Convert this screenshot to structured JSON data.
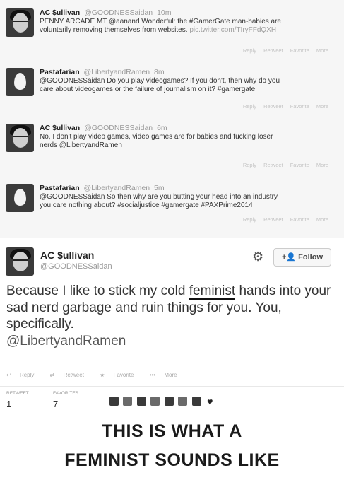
{
  "feed": [
    {
      "name": "AC $ullivan",
      "handle": "@GOODNESSaidan",
      "time": "10m",
      "text_lines": [
        "PENNY ARCADE MT @aanand Wonderful: the #GamerGate man-babies are",
        "voluntarily removing themselves from websites."
      ],
      "link": "pic.twitter.com/TIryFFdQXH",
      "actions": [
        "Reply",
        "Retweet",
        "Favorite",
        "More"
      ],
      "avatar": "photo"
    },
    {
      "name": "Pastafarian",
      "handle": "@LibertyandRamen",
      "time": "8m",
      "text_lines": [
        "@GOODNESSaidan Do you play videogames? If you don't, then why do you",
        "care about videogames or the failure of journalism on it? #gamergate"
      ],
      "link": "",
      "actions": [
        "Reply",
        "Retweet",
        "Favorite",
        "More"
      ],
      "avatar": "egg"
    },
    {
      "name": "AC $ullivan",
      "handle": "@GOODNESSaidan",
      "time": "6m",
      "text_lines": [
        "No, I don't play video games, video games are for babies and fucking loser",
        "nerds @LibertyandRamen"
      ],
      "link": "",
      "actions": [
        "Reply",
        "Retweet",
        "Favorite",
        "More"
      ],
      "avatar": "photo"
    },
    {
      "name": "Pastafarian",
      "handle": "@LibertyandRamen",
      "time": "5m",
      "text_lines": [
        "@GOODNESSaidan So then why are you butting your head into an industry",
        "you care nothing about? #socialjustice #gamergate #PAXPrime2014"
      ],
      "link": "",
      "actions": [
        "Reply",
        "Retweet",
        "Favorite",
        "More"
      ],
      "avatar": "egg"
    }
  ],
  "main": {
    "name": "AC $ullivan",
    "handle": "@GOODNESSaidan",
    "follow_label": "Follow",
    "text_before": "Because I like to stick my cold ",
    "text_highlight": "feminist",
    "text_after": " hands into your sad nerd garbage and ruin things for you. You, specifically.",
    "mention": "@LibertyandRamen",
    "actions": {
      "reply": "Reply",
      "retweet": "Retweet",
      "favorite": "Favorite",
      "more": "More"
    },
    "retweets_label": "RETWEET",
    "retweets_value": "1",
    "favorites_label": "FAVORITES",
    "favorites_value": "7"
  },
  "caption": {
    "line1": "THIS IS WHAT A",
    "line2": "FEMINIST SOUNDS LIKE"
  }
}
